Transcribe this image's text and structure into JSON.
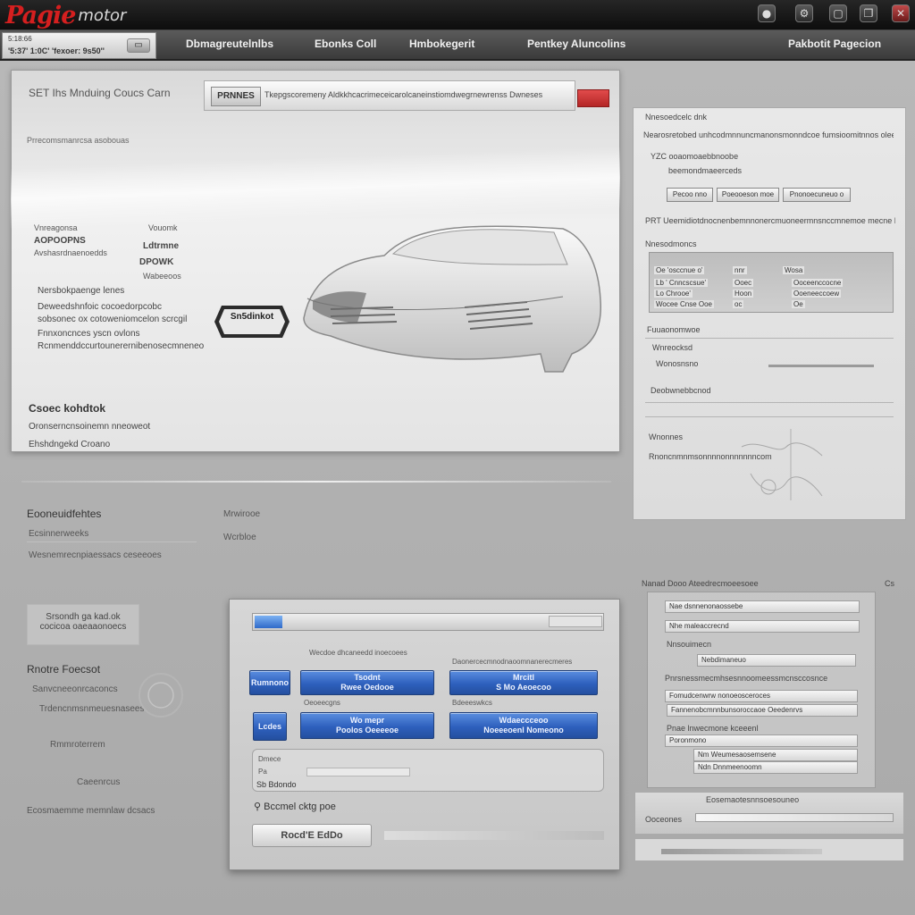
{
  "app": {
    "logo_main": "Pagie",
    "logo_sub": "motor",
    "window_buttons": [
      {
        "icon": "globe-icon",
        "glyph": "●"
      },
      {
        "icon": "settings-icon",
        "glyph": "⚙"
      },
      {
        "icon": "window-icon",
        "glyph": "▢"
      },
      {
        "icon": "restore-icon",
        "glyph": "❐"
      },
      {
        "icon": "close-icon",
        "glyph": "✕"
      }
    ]
  },
  "menubar": {
    "left_line1": "5:18:66",
    "left_line2": "'5:37' 1:0C' 'fexoer: 9s50''",
    "items": [
      "Dbmagreutelnlbs",
      "Ebonks Coll",
      "Hmbokegerit",
      "Pentkey Aluncolins"
    ],
    "right_item": "Pakbotit Pagecion"
  },
  "main_card": {
    "title": "SET Ihs Mnduing Coucs Carn",
    "tab_label": "PRNNES",
    "search_text": "Tkepgscoremeny   Aldkkhcacrimeceicarolcaneinstiomdwegrnewrenss   Dwneses",
    "subtitle": "Prrecomsmanrcsa asobouas",
    "specs_left": [
      "Vnreagonsa",
      "AOPOOPNS",
      "Avshasrdnaenoedds"
    ],
    "specs_mid": [
      "Vouomk",
      "Ldtrmne",
      "DPOWK",
      "Wabeeoos"
    ],
    "badge_label": "Sn5dinkot",
    "desc_lines": [
      "Nersbokpaenge  lenes",
      "Deweedshnfoic cocoedorpcobc",
      "sobsonec ox cotoweniomcelon scrcgil",
      "Fnnxoncnces  yscn ovlons",
      "Rcnmenddccurtounerernibenosecmneneo"
    ],
    "section_heading": "Csoec kohdtok",
    "section_lines": [
      "Oronserncnsoinemn  nneoweot",
      "Ehshdngekd Croano"
    ]
  },
  "lower_left": {
    "heading_left": "Eooneuidfehtes",
    "heading_right": "Mrwirooe",
    "line1": "Ecsinnerweeks",
    "line2_right": "Wcrbloe",
    "line3": "Wesnemrecnpiaessacs ceseeoes",
    "box_line1": "Srsondh ga kad.ok",
    "box_line2": "cocicoa oaeaaonoecs",
    "hist_heading": "Rnotre Foecsot",
    "hist_lines": [
      "Sanvcneeonrcaconcs",
      "Trdencnmsnmeuesnasees",
      "Rmmroterrem",
      "Caeenrcus"
    ],
    "footer": "Ecosmaemme  memnlaw dcsacs"
  },
  "control_panel": {
    "progress_fraction": 0.08,
    "caption_top_left": "Wecdoe dhcaneedd inoecoees",
    "caption_top_right": "Daonercecmnodnaoomnanerecmeres",
    "side_btn1": "Rumnono",
    "side_btn2": "Lcdes",
    "btn1_line1": "Tsodnt",
    "btn1_line2": "Rwee Oedooe",
    "btn2_line1": "Mrcitl",
    "btn2_line2": "S Mo Aeoecoo",
    "caption_mid_left": "Oeoeecgns",
    "caption_mid_right": "Bdeeeswkcs",
    "btn3_line1": "Wo mepr",
    "btn3_line2": "Poolos Oeeeeoe",
    "btn4_line1": "Wdaeccceoo",
    "btn4_line2": "Noeeeoenl Nomeono",
    "field_caption": "Dmece",
    "field_caption2": "Pa",
    "field_value": "Sb Bdondo",
    "search_label": "Bccmel cktg poe",
    "search_icon": "search-icon",
    "action_button": "Rocd'E EdDo"
  },
  "right_top": {
    "title": "Nnesoedcelc dnk",
    "line1": "Nearosretobed  unhcodmnnuncmanonsmonndcoe  fumsioomitnnos oleeronesde",
    "line2": "YZC  ooaomoaebbnoobe",
    "line3": "beemondmaeerceds",
    "buttons": [
      "Pecoo nno",
      "Poeooeson moe",
      "Pnonoecuneuo o"
    ],
    "line4": "PRT  Ueemidiotdnocnenbemnnonercmuoneermnsnccmnemoe  mecne  kv",
    "table_title": "Nnesodmoncs",
    "table_rows": [
      [
        "Oe  'osccnue o'",
        "nnr",
        "Wosa"
      ],
      [
        "Lb  ' Cnncscsue'",
        "Ooec",
        "Ooceenccocne"
      ],
      [
        "Lo  Chrooe'",
        "Hoon",
        "Ooeneeccoew"
      ],
      [
        "Wocee  Cnse  Ooe",
        "oc",
        "Oe"
      ]
    ],
    "detail_title": "Fuuaonomwoe",
    "detail_lines": [
      "Wnreocksd",
      "Wonosnsno",
      "Deobwnebbcnod",
      "Wnonnes",
      "Rnoncnmnmsonnnnonnnnnnncom"
    ]
  },
  "right_bottom": {
    "title": "Nanad Dooo Ateedrecmoeesoee",
    "corner_label": "Cs",
    "inputs": [
      "Nae dsnnenonaossebe",
      "Nhe maleaccrecnd",
      "Nebdimaneuo",
      "Fomudcenwrw nonoeosceroces",
      "Fannenobcmnnbunsoroccaoe  Oeedenrvs",
      "Fanswcmnceiesnemeonoocnoevds"
    ],
    "subhead1": "Nnsouimecn",
    "subhead2": "Pnrsnessmecmhsesnnoomeessmcnsccosnce",
    "subhead3": "Pnae lnwecmone kceeenl",
    "items2": [
      "Poronmono",
      "Nm Weumesaosemsene",
      "Ndn Dnnmeenoomn"
    ],
    "footer_line": "Eosemaotesnnsoesouneo",
    "footer_left": "Ooceones"
  }
}
